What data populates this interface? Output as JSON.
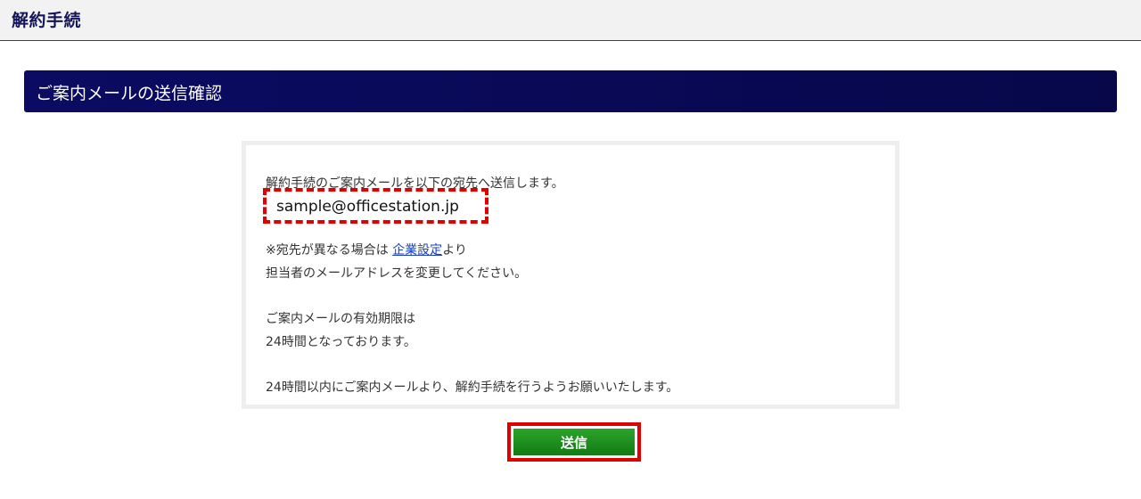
{
  "header": {
    "title": "解約手続"
  },
  "section": {
    "title": "ご案内メールの送信確認"
  },
  "message": {
    "intro": "解約手続のご案内メールを以下の宛先へ送信します。",
    "email": "sample@officestation.jp",
    "note_prefix": "※宛先が異なる場合は ",
    "note_link": "企業設定",
    "note_suffix": "より",
    "note_line2": "担当者のメールアドレスを変更してください。",
    "validity_line1": "ご案内メールの有効期限は",
    "validity_line2": "24時間となっております。",
    "request": "24時間以内にご案内メールより、解約手続を行うようお願いいたします。"
  },
  "actions": {
    "send_label": "送信"
  },
  "colors": {
    "header_bg": "#f2f2f2",
    "section_bar": "#0b0b63",
    "highlight_border": "#e00000",
    "send_button": "#1e8f1e",
    "link": "#1a3fc4"
  }
}
